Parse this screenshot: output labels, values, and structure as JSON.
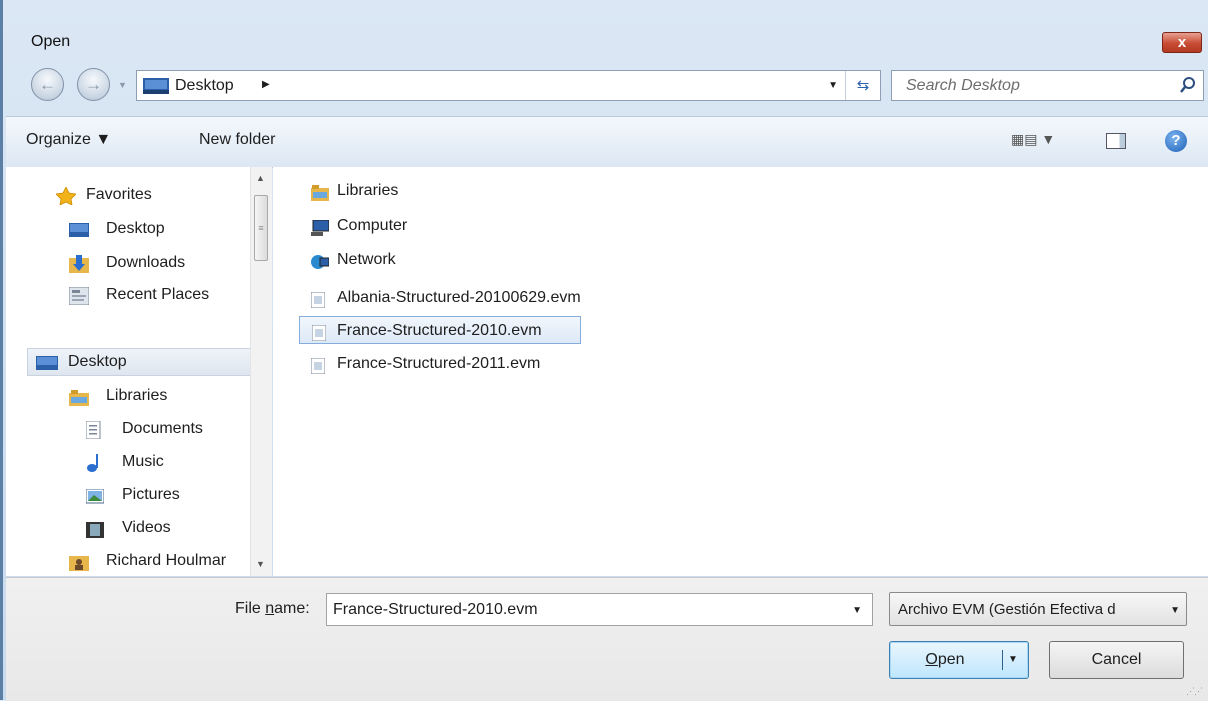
{
  "window": {
    "title": "Open",
    "close_label": "x"
  },
  "address": {
    "location": "Desktop",
    "separator": "▶"
  },
  "search": {
    "placeholder": "Search Desktop"
  },
  "toolbar": {
    "organize": "Organize ▼",
    "new_folder": "New folder",
    "views_arrow": "▼",
    "help": "?"
  },
  "nav": {
    "favorites": "Favorites",
    "fav_items": [
      "Desktop",
      "Downloads",
      "Recent Places"
    ],
    "desktop": "Desktop",
    "libraries": "Libraries",
    "lib_items": [
      "Documents",
      "Music",
      "Pictures",
      "Videos"
    ],
    "user": "Richard Houlmar"
  },
  "files": [
    {
      "name": "Libraries",
      "icon": "libraries-icon"
    },
    {
      "name": "Computer",
      "icon": "computer-icon"
    },
    {
      "name": "Network",
      "icon": "network-icon"
    },
    {
      "name": "Albania-Structured-20100629.evm",
      "icon": "evm-file-icon"
    },
    {
      "name": "France-Structured-2010.evm",
      "icon": "evm-file-icon",
      "selected": true
    },
    {
      "name": "France-Structured-2011.evm",
      "icon": "evm-file-icon"
    }
  ],
  "bottom": {
    "file_name_label_pre": "File ",
    "file_name_label_accel": "n",
    "file_name_label_post": "ame:",
    "file_name_value": "France-Structured-2010.evm",
    "file_type": "Archivo EVM (Gestión Efectiva d",
    "open_accel": "O",
    "open_rest": "pen",
    "cancel": "Cancel"
  },
  "colors": {
    "selection_border": "#84acdd",
    "accent": "#2a62b0",
    "close": "#c84b33"
  }
}
